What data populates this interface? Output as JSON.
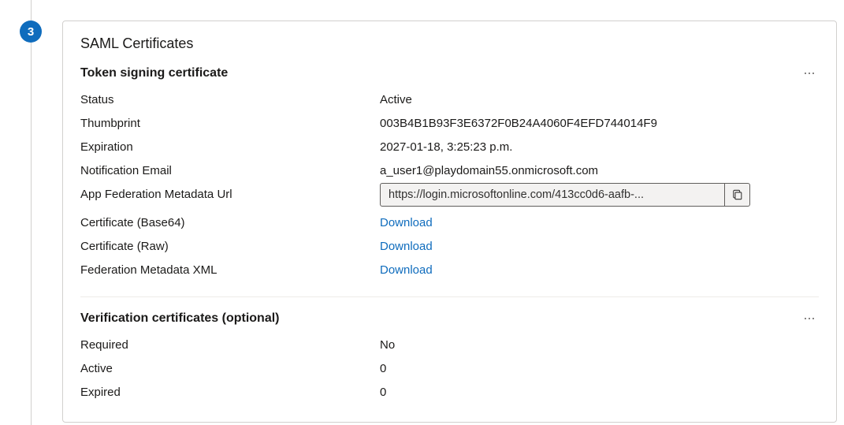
{
  "step": {
    "number": "3"
  },
  "card": {
    "title": "SAML Certificates"
  },
  "token_signing": {
    "title": "Token signing certificate",
    "status_label": "Status",
    "status_value": "Active",
    "thumbprint_label": "Thumbprint",
    "thumbprint_value": "003B4B1B93F3E6372F0B24A4060F4EFD744014F9",
    "expiration_label": "Expiration",
    "expiration_value": "2027-01-18, 3:25:23 p.m.",
    "email_label": "Notification Email",
    "email_value": "a_user1@playdomain55.onmicrosoft.com",
    "metadata_url_label": "App Federation Metadata Url",
    "metadata_url_value": "https://login.microsoftonline.com/413cc0d6-aafb-...",
    "cert_base64_label": "Certificate (Base64)",
    "cert_base64_link": "Download",
    "cert_raw_label": "Certificate (Raw)",
    "cert_raw_link": "Download",
    "fed_xml_label": "Federation Metadata XML",
    "fed_xml_link": "Download"
  },
  "verification": {
    "title": "Verification certificates (optional)",
    "required_label": "Required",
    "required_value": "No",
    "active_label": "Active",
    "active_value": "0",
    "expired_label": "Expired",
    "expired_value": "0"
  }
}
